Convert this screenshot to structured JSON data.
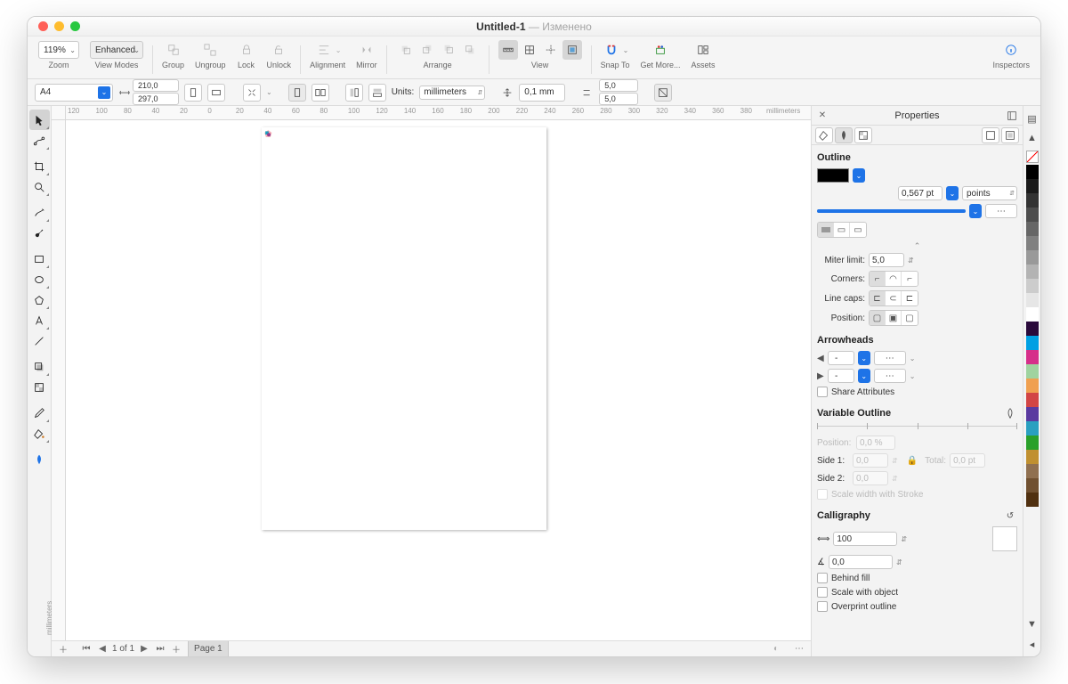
{
  "title": {
    "name": "Untitled-1",
    "status": "Изменено"
  },
  "toolbar": {
    "zoom_value": "119%",
    "zoom_label": "Zoom",
    "view_mode_value": "Enhanced",
    "view_modes_label": "View Modes",
    "group_label": "Group",
    "ungroup_label": "Ungroup",
    "lock_label": "Lock",
    "unlock_label": "Unlock",
    "alignment_label": "Alignment",
    "mirror_label": "Mirror",
    "arrange_label": "Arrange",
    "view_label": "View",
    "snap_to_label": "Snap To",
    "get_more_label": "Get More...",
    "assets_label": "Assets",
    "inspectors_label": "Inspectors"
  },
  "optbar": {
    "page_size": "A4",
    "width": "210,0",
    "height": "297,0",
    "units_label": "Units:",
    "units_value": "millimeters",
    "nudge": "0,1 mm",
    "dup_x": "5,0",
    "dup_y": "5,0"
  },
  "ruler_ticks": [
    "120",
    "100",
    "80",
    "40",
    "20",
    "0",
    "20",
    "40",
    "60",
    "80",
    "100",
    "120",
    "140",
    "160",
    "180",
    "200",
    "220",
    "240",
    "260",
    "280",
    "300",
    "320",
    "340",
    "360",
    "380"
  ],
  "ruler_v_label": "millimeters",
  "ruler_h_unit": "millimeters",
  "status": {
    "pages": "1 of 1",
    "tab": "Page 1"
  },
  "props": {
    "title": "Properties",
    "outline_title": "Outline",
    "stroke_width": "0,567 pt",
    "stroke_unit": "points",
    "miter_label": "Miter limit:",
    "miter_value": "5,0",
    "corners_label": "Corners:",
    "caps_label": "Line caps:",
    "position_label": "Position:",
    "arrows_title": "Arrowheads",
    "share_attrs": "Share Attributes",
    "var_outline_title": "Variable Outline",
    "var_position_label": "Position:",
    "var_position_value": "0,0 %",
    "side1_label": "Side 1:",
    "side2_label": "Side 2:",
    "side_value": "0,0",
    "total_label": "Total:",
    "total_value": "0,0 pt",
    "scale_stroke": "Scale width with Stroke",
    "cal_title": "Calligraphy",
    "cal_stretch": "100",
    "cal_angle": "0,0",
    "behind_fill": "Behind fill",
    "scale_obj": "Scale with object",
    "overprint": "Overprint outline"
  },
  "colors": {
    "accent": "#1e73e7",
    "pentagon": "#f9b2b8",
    "square": "#159fc1",
    "circle": "#933b8e",
    "stroke": "#1a1a1a"
  },
  "palette": [
    "#000000",
    "#1a1a1a",
    "#333333",
    "#4d4d4d",
    "#666666",
    "#808080",
    "#999999",
    "#b3b3b3",
    "#cccccc",
    "#e6e6e6",
    "#ffffff",
    "#2a0a3b",
    "#00a0e3",
    "#d62f8a",
    "#9fd39f",
    "#f0a050",
    "#d24545",
    "#5a3aa0",
    "#2aa0c0",
    "#2aa02a",
    "#c09030",
    "#907050",
    "#705030",
    "#503010"
  ]
}
